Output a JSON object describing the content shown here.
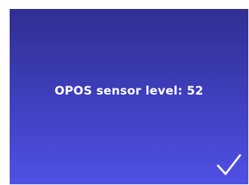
{
  "screen": {
    "message": "OPOS sensor level: 52",
    "confirm_icon": "checkmark-icon",
    "colors": {
      "background_top": "#2f2f92",
      "background_bottom": "#5050e6",
      "text": "#ffffff"
    }
  }
}
